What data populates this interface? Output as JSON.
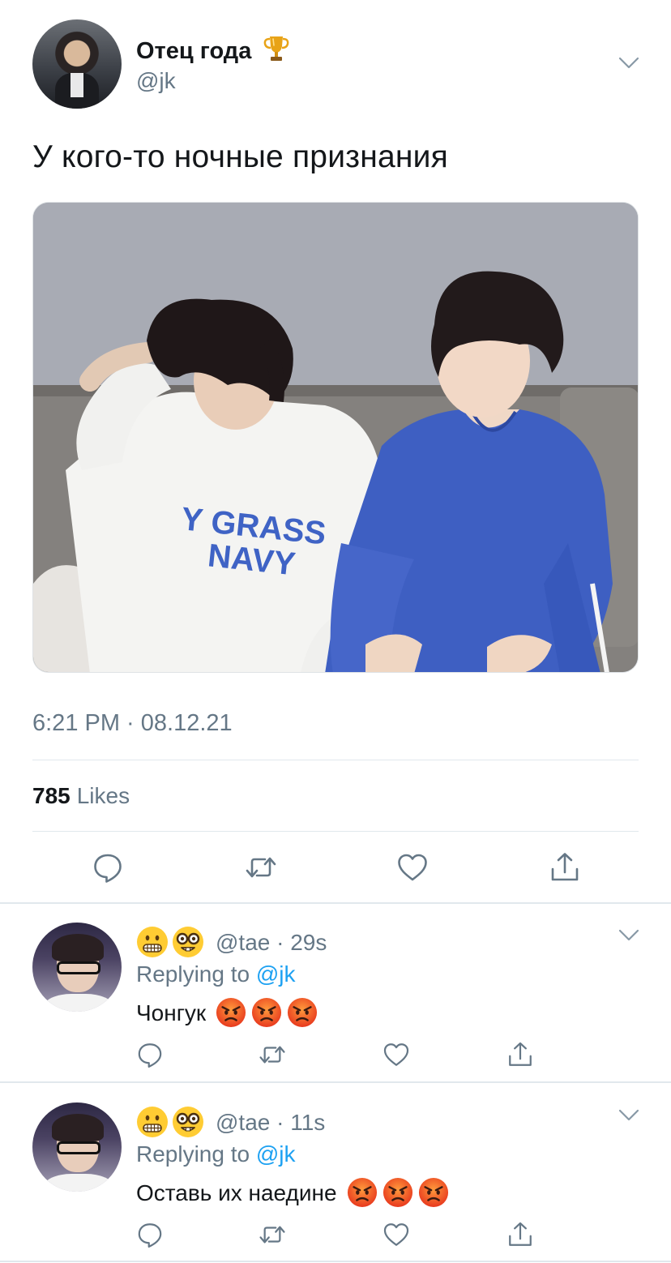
{
  "tweet": {
    "display_name": "Отец года",
    "handle": "@jk",
    "text": "У кого-то ночные признания",
    "shirt_text_line1": "Y GRASS",
    "shirt_text_line2": "NAVY",
    "timestamp": "6:21 PM · 08.12.21",
    "likes_count": "785",
    "likes_label": "Likes"
  },
  "replies": [
    {
      "handle_time": "@tae · 29s",
      "replying_label": "Replying to",
      "replying_mention": "@jk",
      "text": "Чонгук"
    },
    {
      "handle_time": "@tae · 11s",
      "replying_label": "Replying to",
      "replying_mention": "@jk",
      "text": "Оставь их наедине"
    }
  ],
  "icons": {
    "header": [
      "trophy-icon",
      "chevron-down-icon"
    ],
    "actions": [
      "reply-icon",
      "retweet-icon",
      "like-icon",
      "share-icon"
    ],
    "reply_emojis": [
      "grimacing-face-icon",
      "nerd-face-icon",
      "angry-face-icon"
    ]
  },
  "colors": {
    "text": "#14171a",
    "secondary": "#657786",
    "link": "#1da1f2",
    "divider": "#e1e8ed"
  }
}
